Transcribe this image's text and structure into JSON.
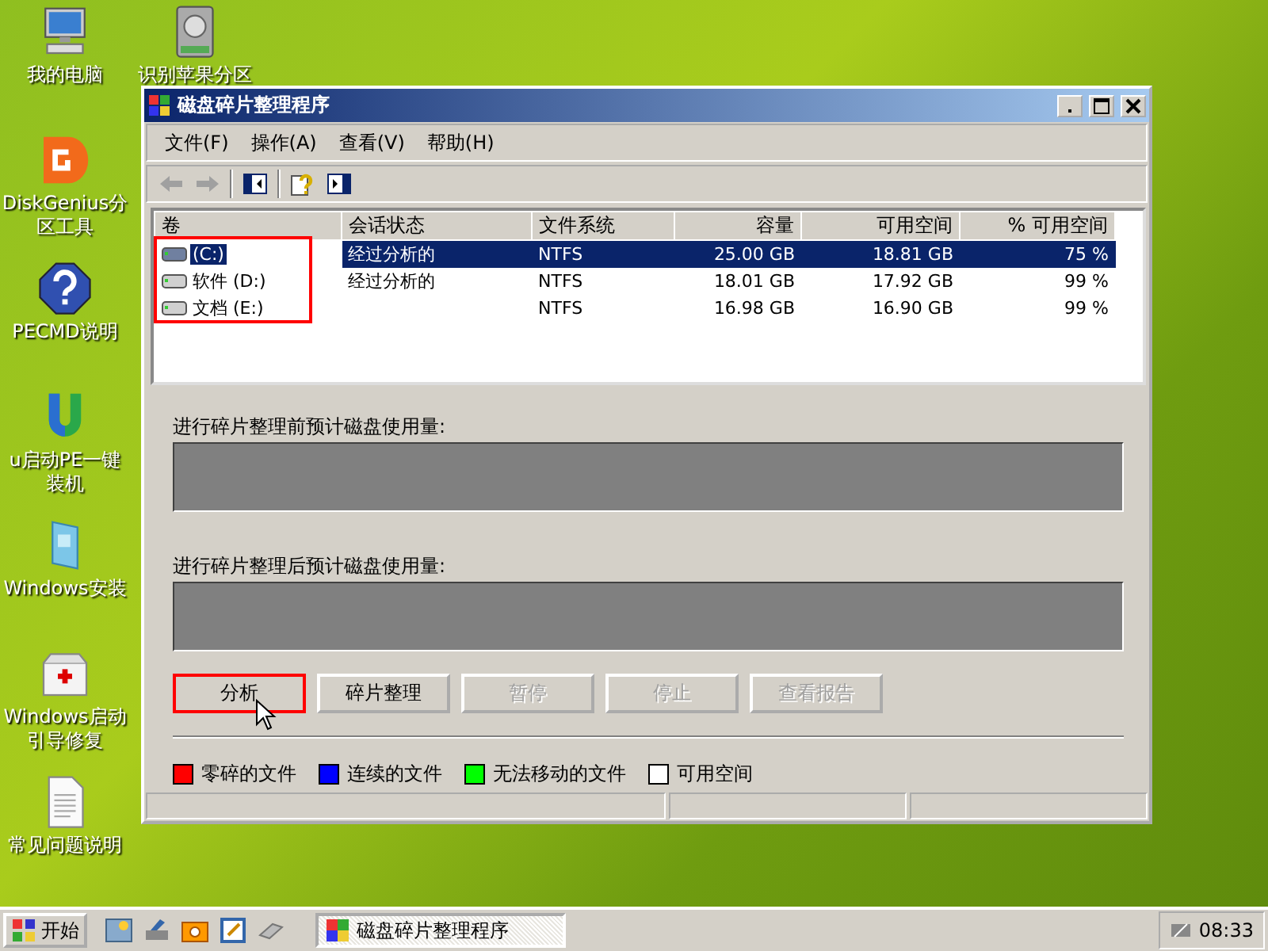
{
  "desktop_icons": [
    {
      "label": "我的电脑",
      "kind": "computer"
    },
    {
      "label": "DiskGenius分区工具",
      "kind": "diskgenius"
    },
    {
      "label": "PECMD说明",
      "kind": "help"
    },
    {
      "label": "u启动PE一键装机",
      "kind": "ulogo"
    },
    {
      "label": "Windows安装",
      "kind": "installer"
    },
    {
      "label": "Windows启动引导修复",
      "kind": "toolbox"
    },
    {
      "label": "常见问题说明",
      "kind": "document"
    },
    {
      "label": "识别苹果分区",
      "kind": "drive"
    }
  ],
  "window": {
    "title": "磁盘碎片整理程序",
    "menu": [
      "文件(F)",
      "操作(A)",
      "查看(V)",
      "帮助(H)"
    ],
    "volumes": {
      "highlighted": true,
      "columns": [
        "卷",
        "会话状态",
        "文件系统",
        "容量",
        "可用空间",
        "% 可用空间"
      ],
      "rows": [
        {
          "volume": "(C:)",
          "session_status": "经过分析的",
          "file_system": "NTFS",
          "capacity": "25.00 GB",
          "free_space": "18.81 GB",
          "percent_free": "75 %",
          "selected": true
        },
        {
          "volume": "软件 (D:)",
          "session_status": "经过分析的",
          "file_system": "NTFS",
          "capacity": "18.01 GB",
          "free_space": "17.92 GB",
          "percent_free": "99 %",
          "selected": false
        },
        {
          "volume": "文档 (E:)",
          "session_status": "",
          "file_system": "NTFS",
          "capacity": "16.98 GB",
          "free_space": "16.90 GB",
          "percent_free": "99 %",
          "selected": false
        }
      ]
    },
    "before_label": "进行碎片整理前预计磁盘使用量:",
    "after_label": "进行碎片整理后预计磁盘使用量:",
    "buttons": [
      {
        "label": "分析",
        "disabled": false,
        "highlighted": true
      },
      {
        "label": "碎片整理",
        "disabled": false,
        "highlighted": false
      },
      {
        "label": "暂停",
        "disabled": true,
        "highlighted": false
      },
      {
        "label": "停止",
        "disabled": true,
        "highlighted": false
      },
      {
        "label": "查看报告",
        "disabled": true,
        "highlighted": false
      }
    ],
    "legend": [
      {
        "label": "零碎的文件",
        "color": "#ff0000"
      },
      {
        "label": "连续的文件",
        "color": "#0000ff"
      },
      {
        "label": "无法移动的文件",
        "color": "#00ff00"
      },
      {
        "label": "可用空间",
        "color": "#ffffff"
      }
    ]
  },
  "taskbar": {
    "start": "开始",
    "tasks": [
      {
        "label": "磁盘碎片整理程序",
        "selected": true
      }
    ],
    "clock": "08:33"
  }
}
